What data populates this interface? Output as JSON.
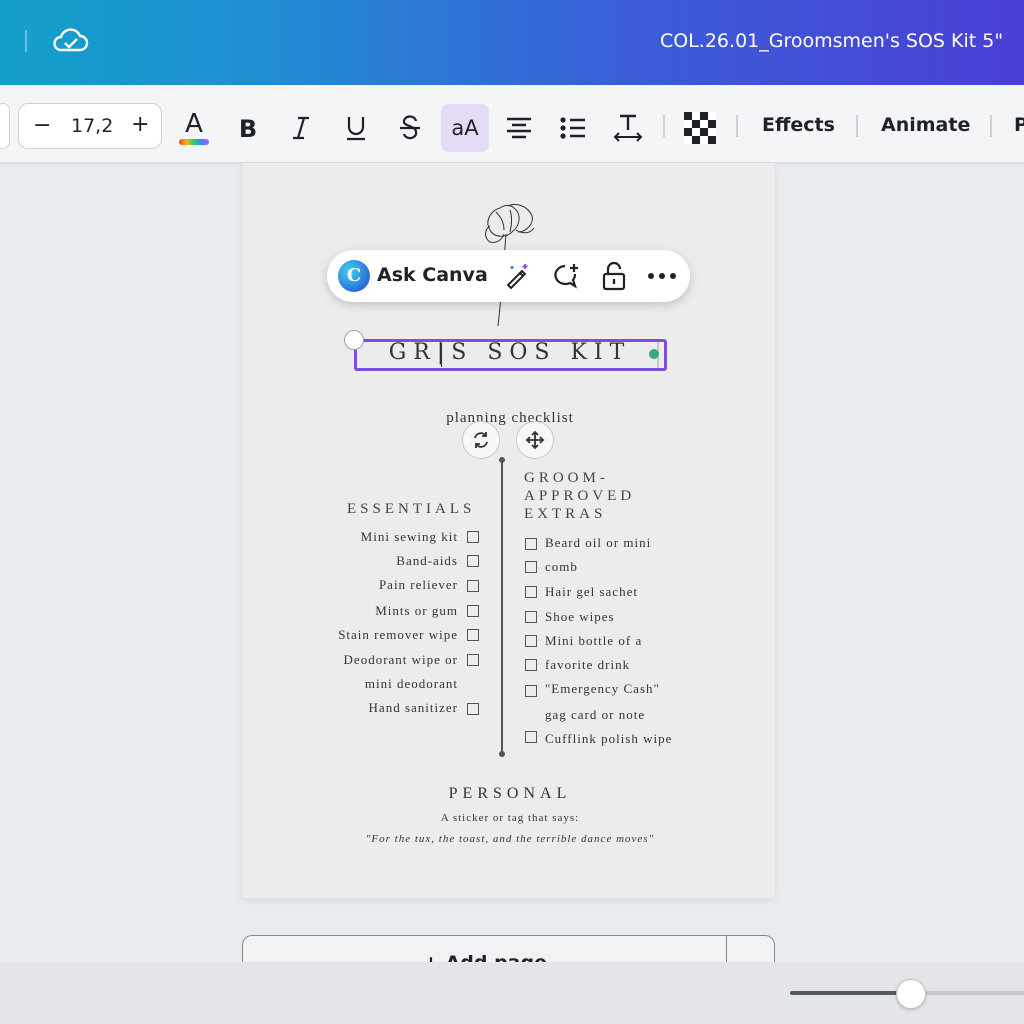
{
  "header": {
    "document_title": "COL.26.01_Groomsmen's SOS Kit 5\""
  },
  "toolbar": {
    "font_size": "17,2",
    "minus_label": "−",
    "plus_label": "+",
    "color_icon_letter": "A",
    "case_label": "aA",
    "effects_label": "Effects",
    "animate_label": "Animate",
    "next_partial_label": "P"
  },
  "ask_canva": {
    "label": "Ask Canva",
    "logo_letter": "C"
  },
  "design": {
    "heading": "GR|S SOS KIT",
    "subheading": "planning checklist",
    "essentials": {
      "title": "ESSENTIALS",
      "items": [
        "Mini sewing kit",
        "Band-aids",
        "Pain reliever",
        "Mints or gum",
        "Stain remover wipe",
        "Deodorant wipe or",
        "mini deodorant",
        "Hand sanitizer"
      ]
    },
    "extras": {
      "title_line1": "GROOM-",
      "title_line2": "APPROVED",
      "title_line3": "EXTRAS",
      "items": [
        "Beard oil or mini",
        "comb",
        "Hair gel sachet",
        "Shoe wipes",
        "Mini bottle of a",
        "favorite drink",
        "\"Emergency Cash\"",
        "gag card or note",
        "Cufflink polish wipe"
      ]
    },
    "personal": {
      "title": "PERSONAL",
      "line1": "A sticker or tag that says:",
      "line2": "\"For the tux, the toast, and the terrible dance moves\""
    }
  },
  "add_page": {
    "label": "+ Add page",
    "more_icon": "chevron-down-icon"
  },
  "zoom": {
    "level_fraction": 0.5
  },
  "colors": {
    "selection": "#7d4de0",
    "header_start": "#13a0c8",
    "header_end": "#4a3fd6",
    "active_tool": "#e4dcf5"
  }
}
